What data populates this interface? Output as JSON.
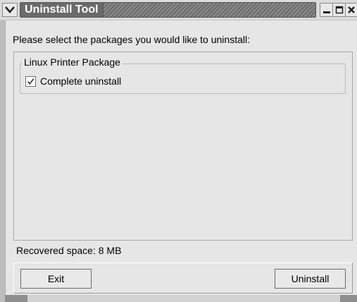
{
  "window": {
    "title": "Uninstall Tool"
  },
  "titlebar_icons": {
    "menu": "chevron-down-icon",
    "minimize": "minimize-icon",
    "maximize": "maximize-icon",
    "close": "close-icon"
  },
  "content": {
    "instruction": "Please select the packages you would like to uninstall:",
    "package_group": {
      "name": "Linux Printer Package",
      "option_label": "Complete uninstall",
      "option_checked": true
    },
    "recovered_space": "Recovered space:  8 MB"
  },
  "buttons": {
    "exit": "Exit",
    "uninstall": "Uninstall"
  },
  "colors": {
    "window_bg": "#e6e6e6",
    "title_text": "#ffffff",
    "title_bar": "#6a6a6a"
  }
}
